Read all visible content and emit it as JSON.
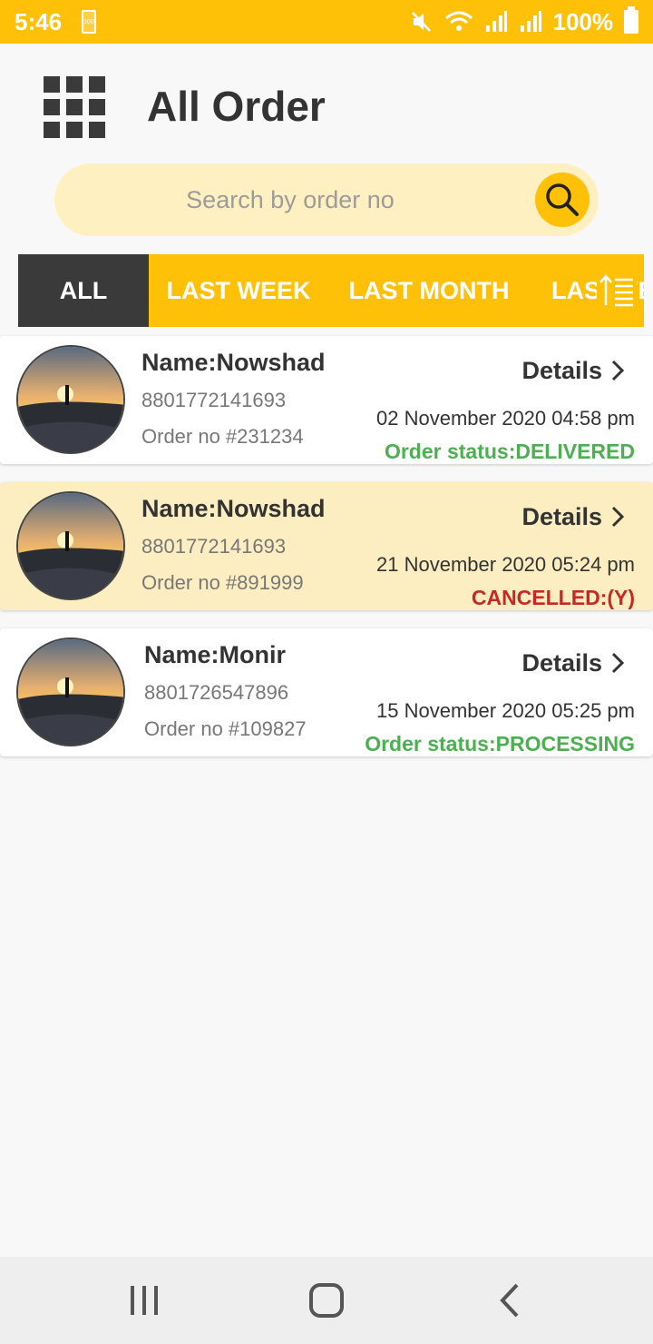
{
  "status_bar": {
    "time": "5:46",
    "battery_small_label": "100",
    "battery_percent": "100%"
  },
  "header": {
    "title": "All Order",
    "menu_icon": "grid-icon"
  },
  "search": {
    "placeholder": "Search by order no",
    "icon": "search-icon"
  },
  "tabs": [
    {
      "label": "ALL",
      "active": true
    },
    {
      "label": "LAST WEEK",
      "active": false
    },
    {
      "label": "LAST MONTH",
      "active": false
    },
    {
      "label": "LAST YEAR",
      "active": false
    }
  ],
  "orders": [
    {
      "name": "Name:Nowshad",
      "phone": "8801772141693",
      "order_no": "Order no #231234",
      "details_label": "Details",
      "date": "02 November 2020 04:58 pm",
      "status": "Order status:DELIVERED",
      "status_color": "#4caf50",
      "highlighted": false
    },
    {
      "name": "Name:Nowshad",
      "phone": "8801772141693",
      "order_no": "Order no #891999",
      "details_label": "Details",
      "date": "21 November 2020 05:24 pm",
      "status": "CANCELLED:(Y)",
      "status_color": "#c62828",
      "highlighted": true
    },
    {
      "name": "Name:Monir",
      "phone": "8801726547896",
      "order_no": "Order no #109827",
      "details_label": "Details",
      "date": "15 November 2020 05:25 pm",
      "status": "Order status:PROCESSING",
      "status_color": "#4caf50",
      "highlighted": false
    }
  ],
  "colors": {
    "accent": "#ffc107",
    "active_tab": "#3a3a3a",
    "highlight_row": "#fdeec2",
    "search_bg": "#fff0c2"
  }
}
